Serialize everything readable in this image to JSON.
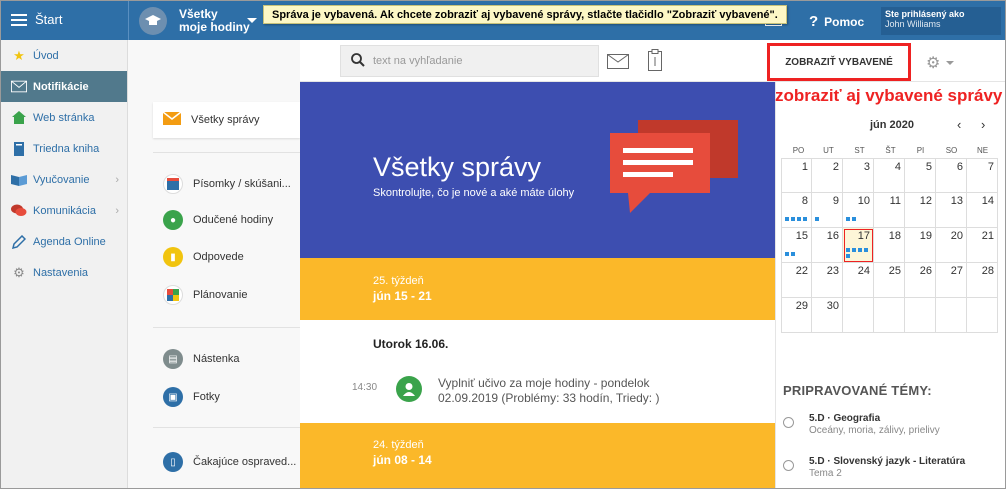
{
  "topbar": {
    "start_label": "Štart",
    "subject_label_line1": "Všetky",
    "subject_label_line2": "moje hodiny",
    "tooltip": "Správa je vybavená. Ak chcete zobraziť aj vybavené správy, stlačte tlačidlo \"Zobraziť vybavené\".",
    "help_label": "Pomoc",
    "logged_as_label": "Ste prihlásený ako",
    "user_name": "John Williams"
  },
  "sidebar": {
    "items": [
      {
        "label": "Úvod",
        "icon": "star-icon"
      },
      {
        "label": "Notifikácie",
        "icon": "mail-icon",
        "active": true
      },
      {
        "label": "Web stránka",
        "icon": "house-icon"
      },
      {
        "label": "Triedna kniha",
        "icon": "book-icon"
      },
      {
        "label": "Vyučovanie",
        "icon": "open-book-icon"
      },
      {
        "label": "Komunikácia",
        "icon": "chat-icon"
      },
      {
        "label": "Agenda Online",
        "icon": "pencil-icon"
      },
      {
        "label": "Nastavenia",
        "icon": "gear-icon"
      }
    ]
  },
  "folders": [
    {
      "label": "Všetky správy",
      "icon": "envelope-icon",
      "color": "#f39c12"
    },
    {
      "label": "Písomky / skúšani...",
      "icon": "calendar-icon",
      "color": "#2e6fa7"
    },
    {
      "label": "Odučené hodiny",
      "icon": "person-icon",
      "color": "#3aa34b"
    },
    {
      "label": "Odpovede",
      "icon": "chart-icon",
      "color": "#f1c40f"
    },
    {
      "label": "Plánovanie",
      "icon": "plan-icon",
      "color": "#e74c3c"
    },
    {
      "label": "Nástenka",
      "icon": "board-icon",
      "color": "#7f8c8d"
    },
    {
      "label": "Fotky",
      "icon": "photo-icon",
      "color": "#2e6fa7"
    },
    {
      "label": "Čakajúce ospraved...",
      "icon": "excuse-icon",
      "color": "#2e6fa7"
    }
  ],
  "search": {
    "placeholder": "text na vyhľadanie"
  },
  "show_resolved_button": "ZOBRAZIŤ VYBAVENÉ",
  "annotation": "zobraziť aj vybavené správy",
  "hero": {
    "title": "Všetky správy",
    "subtitle": "Skontrolujte, čo je nové a aké máte úlohy"
  },
  "weeks": [
    {
      "label": "25. týždeň",
      "dates": "jún 15 - 21"
    },
    {
      "label": "24. týždeň",
      "dates": "jún 08 - 14"
    }
  ],
  "day": {
    "heading": "Utorok 16.06.",
    "message_time": "14:30",
    "message_line1": "Vyplniť učivo za moje hodiny - pondelok",
    "message_line2": "02.09.2019 (Problémy: 33 hodín, Triedy: )"
  },
  "calendar": {
    "month": "jún 2020",
    "prev": "‹",
    "next": "›",
    "dow": [
      "PO",
      "UT",
      "ST",
      "ŠT",
      "PI",
      "SO",
      "NE"
    ],
    "days": [
      [
        "1",
        "2",
        "3",
        "4",
        "5",
        "6",
        "7"
      ],
      [
        "8",
        "9",
        "10",
        "11",
        "12",
        "13",
        "14"
      ],
      [
        "15",
        "16",
        "17",
        "18",
        "19",
        "20",
        "21"
      ],
      [
        "22",
        "23",
        "24",
        "25",
        "26",
        "27",
        "28"
      ],
      [
        "29",
        "30",
        "",
        "",
        "",
        "",
        ""
      ]
    ],
    "today": "17",
    "accent": "#2a8fdc"
  },
  "topics": {
    "title": "Pripravované témy:",
    "items": [
      {
        "title": "5.D · Geografia",
        "subtitle": "Oceány, moria, zálivy, prielivy"
      },
      {
        "title": "5.D · Slovenský jazyk - Literatúra",
        "subtitle": "Tema 2"
      }
    ]
  },
  "colors": {
    "topbar": "#2e6fa7",
    "hero": "#3d4eb0",
    "week": "#fbb829",
    "annotation": "#ee2222"
  }
}
